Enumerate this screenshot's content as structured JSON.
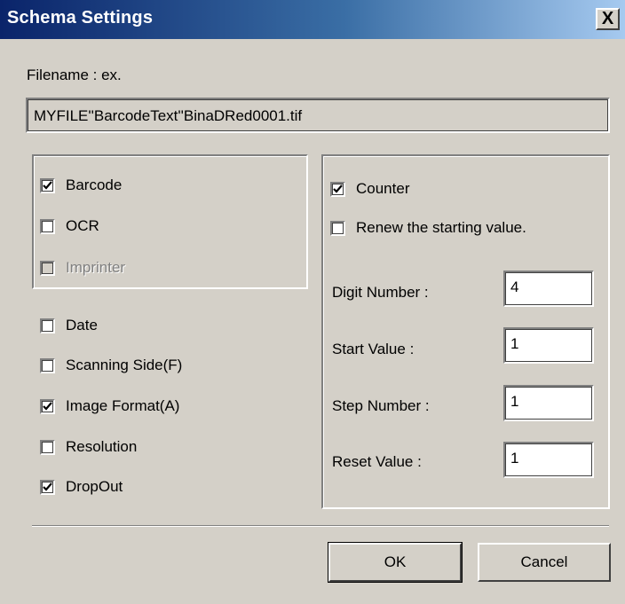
{
  "window": {
    "title": "Schema Settings",
    "close_label": "X"
  },
  "filename": {
    "label": "Filename : ex.",
    "value": "MYFILE''BarcodeText''BinaDRed0001.tif"
  },
  "left_group": {
    "items": [
      {
        "label": "Barcode",
        "checked": true,
        "enabled": true
      },
      {
        "label": "OCR",
        "checked": false,
        "enabled": true
      },
      {
        "label": "Imprinter",
        "checked": false,
        "enabled": false
      }
    ]
  },
  "left_options": {
    "items": [
      {
        "label": "Date",
        "checked": false
      },
      {
        "label": "Scanning Side(F)",
        "checked": false
      },
      {
        "label": "Image Format(A)",
        "checked": true
      },
      {
        "label": "Resolution",
        "checked": false
      },
      {
        "label": "DropOut",
        "checked": true
      }
    ]
  },
  "counter": {
    "counter_label": "Counter",
    "counter_checked": true,
    "renew_label": "Renew the starting value.",
    "renew_checked": false,
    "fields": [
      {
        "label": "Digit Number :",
        "value": "4"
      },
      {
        "label": "Start Value :",
        "value": "1"
      },
      {
        "label": "Step Number :",
        "value": "1"
      },
      {
        "label": "Reset Value :",
        "value": "1"
      }
    ]
  },
  "buttons": {
    "ok": "OK",
    "cancel": "Cancel"
  }
}
